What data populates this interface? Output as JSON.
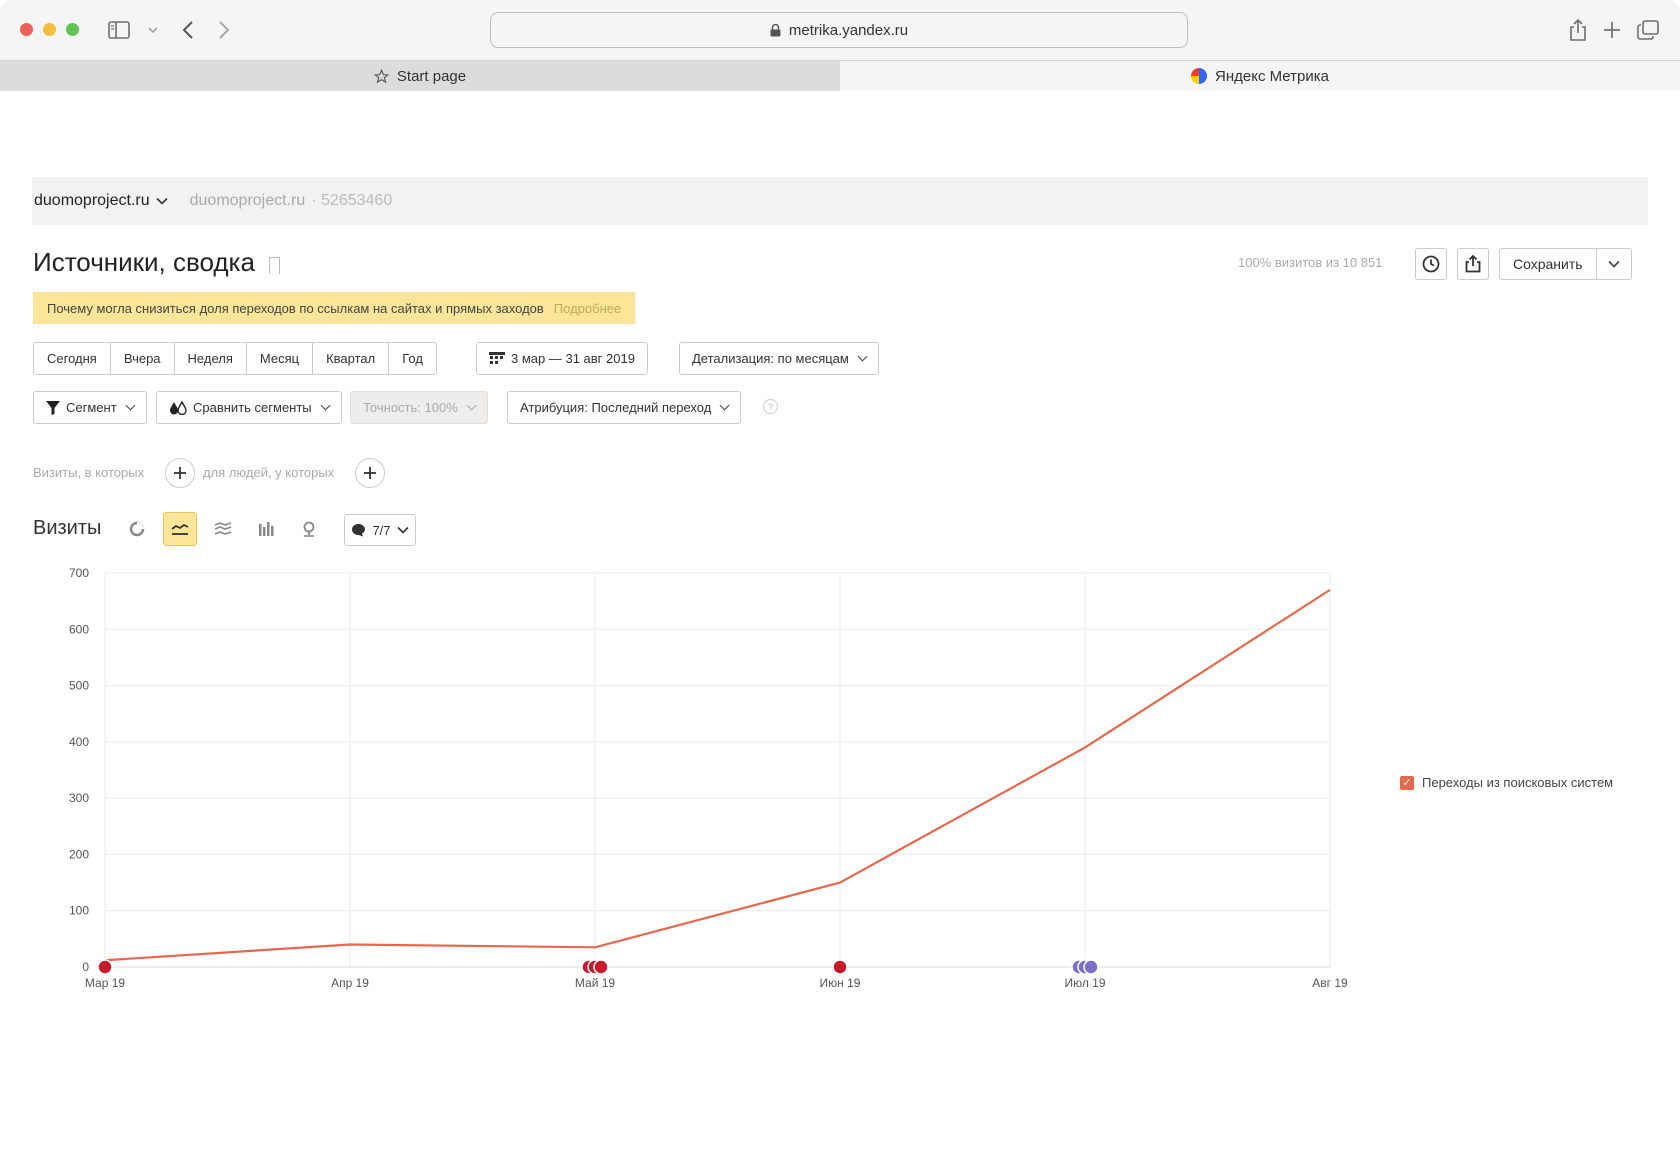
{
  "browser": {
    "url": "metrika.yandex.ru",
    "tabs": [
      {
        "label": "Start page"
      },
      {
        "label": "Яндекс Метрика"
      }
    ]
  },
  "breadcrumb": {
    "counter": "duomoproject.ru",
    "site": "duomoproject.ru",
    "counter_id": "· 52653460"
  },
  "page": {
    "title": "Источники, сводка",
    "visits_share": "100% визитов из 10 851",
    "save_label": "Сохранить"
  },
  "notice": {
    "text": "Почему могла снизиться доля переходов по ссылкам на сайтах и прямых заходов",
    "link": "Подробнее"
  },
  "period": {
    "buttons": [
      "Сегодня",
      "Вчера",
      "Неделя",
      "Месяц",
      "Квартал",
      "Год"
    ],
    "range": "3 мар — 31 авг 2019",
    "detail": "Детализация: по месяцам"
  },
  "filters": {
    "segment": "Сегмент",
    "compare": "Сравнить сегменты",
    "accuracy": "Точность: 100%",
    "attribution": "Атрибуция: Последний переход",
    "visits_where": "Визиты, в которых",
    "people_where": "для людей, у которых"
  },
  "chart_section": {
    "title": "Визиты",
    "series_count": "7/7"
  },
  "colors": {
    "series": "#e4684c",
    "accent": "#fbe598",
    "annotation_red": "#c8192e",
    "annotation_purple": "#7b6fc9"
  },
  "chart_data": {
    "type": "line",
    "categories": [
      "Мар 19",
      "Апр 19",
      "Май 19",
      "Июн 19",
      "Июл 19",
      "Авг 19"
    ],
    "series": [
      {
        "name": "Переходы из поисковых систем",
        "values": [
          12,
          40,
          35,
          150,
          390,
          670
        ]
      }
    ],
    "ylim": [
      0,
      700
    ],
    "yticks": [
      0,
      100,
      200,
      300,
      400,
      500,
      600,
      700
    ],
    "grid": true,
    "legend": "right"
  }
}
